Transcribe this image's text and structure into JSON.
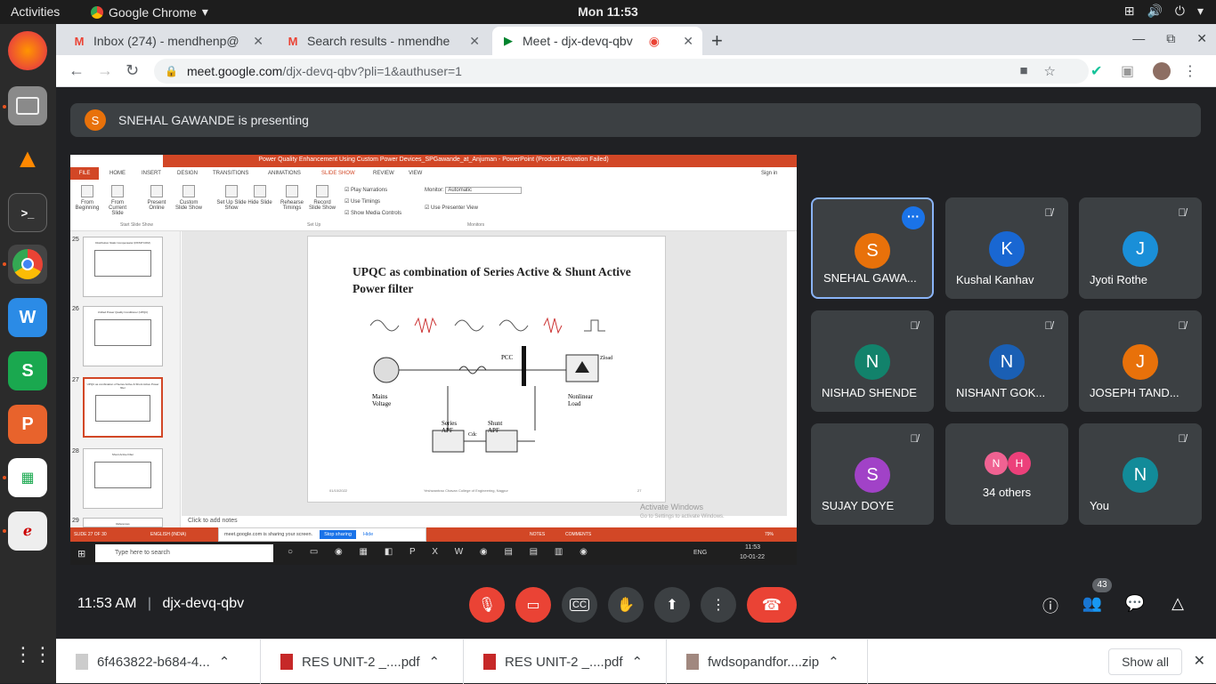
{
  "topbar": {
    "activities": "Activities",
    "app": "Google Chrome",
    "clock": "Mon 11:53"
  },
  "tabs": [
    {
      "title": "Inbox (274) - mendhenp@",
      "icon": "gmail-icon"
    },
    {
      "title": "Search results - nmendhe",
      "icon": "gmail-icon"
    },
    {
      "title": "Meet - djx-devq-qbv",
      "icon": "meet-icon"
    }
  ],
  "address": {
    "domain": "meet.google.com",
    "path": "/djx-devq-qbv?pli=1&authuser=1"
  },
  "presenting": {
    "initial": "S",
    "text": "SNEHAL GAWANDE is presenting"
  },
  "shared_screen": {
    "title": "Power Quality Enhancement Using Custom Power Devices_SPGawande_at_Anjuman - PowerPoint (Product Activation Failed)",
    "sign_in": "Sign in",
    "ribbon_tabs": [
      "FILE",
      "HOME",
      "INSERT",
      "DESIGN",
      "TRANSITIONS",
      "ANIMATIONS",
      "SLIDE SHOW",
      "REVIEW",
      "VIEW"
    ],
    "ribbon_buttons": [
      "From Beginning",
      "From Current Slide",
      "Present Online",
      "Custom Slide Show",
      "Set Up Slide Show",
      "Hide Slide",
      "Rehearse Timings",
      "Record Slide Show"
    ],
    "checks": [
      "Play Narrations",
      "Use Timings",
      "Show Media Controls"
    ],
    "monitor_label": "Monitor:",
    "monitor_value": "Automatic",
    "presenter_view": "Use Presenter View",
    "groups": [
      "Start Slide Show",
      "Set Up",
      "Monitors"
    ],
    "thumbs": [
      {
        "num": "25",
        "title": "Distribution Static Compensator (DSTATCOM)"
      },
      {
        "num": "26",
        "title": "Unified Power Quality Conditioner (UPQC)"
      },
      {
        "num": "27",
        "title": "UPQC as combination of Series Active & Shunt Active Power filter"
      },
      {
        "num": "28",
        "title": "Shunt Active Filter"
      },
      {
        "num": "29",
        "title": "References"
      }
    ],
    "slide_title": "UPQC  as combination of Series Active & Shunt Active Power filter",
    "slide_date": "01/10/2022",
    "slide_college": "Yeshwantrao Chavan College of Engineering, Nagpur",
    "slide_page": "27",
    "diagram_labels": [
      "Mains Voltage",
      "PCC",
      "Nonlinear Load",
      "Series APF",
      "Shunt APF",
      "Zload",
      "Cdc"
    ],
    "notes": "Click to add notes",
    "watermark": "Activate Windows",
    "watermark_sub": "Go to Settings to activate Windows.",
    "status_left": "SLIDE 27 OF 30",
    "status_lang": "ENGLISH (INDIA)",
    "status_notes": "NOTES",
    "status_comments": "COMMENTS",
    "zoom": "79%",
    "share_msg": "meet.google.com is sharing your screen.",
    "stop_sharing": "Stop sharing",
    "hide": "Hide",
    "search_placeholder": "Type here to search",
    "tray_lang": "ENG",
    "tray_time": "11:53",
    "tray_date": "10-01-22"
  },
  "participants": [
    {
      "name": "SNEHAL GAWA...",
      "initial": "S",
      "color": "#e8710a",
      "active": true
    },
    {
      "name": "Kushal Kanhav",
      "initial": "K",
      "color": "#1967d2"
    },
    {
      "name": "Jyoti Rothe",
      "initial": "J",
      "color": "#1a8fd8"
    },
    {
      "name": "NISHAD SHENDE",
      "initial": "N",
      "color": "#12826b"
    },
    {
      "name": "NISHANT GOK...",
      "initial": "N",
      "color": "#1a5fb4"
    },
    {
      "name": "JOSEPH TAND...",
      "initial": "J",
      "color": "#e8710a"
    },
    {
      "name": "SUJAY DOYE",
      "initial": "S",
      "color": "#a142c7"
    },
    {
      "others": "34 others",
      "minis": [
        "N",
        "H"
      ]
    },
    {
      "name": "You",
      "initial": "N",
      "color": "#128b99"
    }
  ],
  "meeting": {
    "time": "11:53 AM",
    "code": "djx-devq-qbv",
    "people_count": "43"
  },
  "downloads": [
    {
      "name": "6f463822-b684-4...",
      "icon": "file-icon"
    },
    {
      "name": "RES UNIT-2 _....pdf",
      "icon": "pdf-icon"
    },
    {
      "name": "RES UNIT-2 _....pdf",
      "icon": "pdf-icon"
    },
    {
      "name": "fwdsopandfor....zip",
      "icon": "zip-icon"
    }
  ],
  "downloads_show_all": "Show all"
}
